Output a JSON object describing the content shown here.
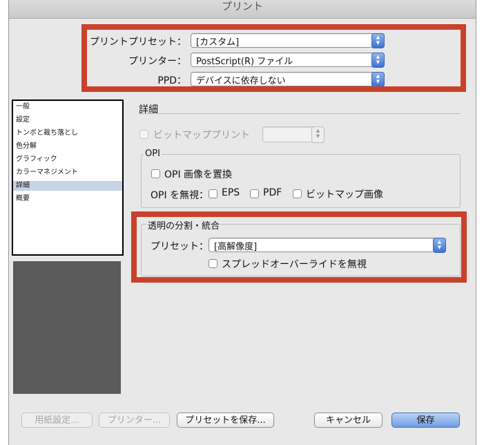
{
  "window": {
    "title": "プリント"
  },
  "top": {
    "preset_label": "プリントプリセット：",
    "preset_value": "[カスタム]",
    "printer_label": "プリンター：",
    "printer_value": "PostScript(R) ファイル",
    "ppd_label": "PPD：",
    "ppd_value": "デバイスに依存しない"
  },
  "sidebar": {
    "items": [
      {
        "label": "一般",
        "selected": false
      },
      {
        "label": "設定",
        "selected": false
      },
      {
        "label": "トンボと裁ち落とし",
        "selected": false
      },
      {
        "label": "色分解",
        "selected": false
      },
      {
        "label": "グラフィック",
        "selected": false
      },
      {
        "label": "カラーマネジメント",
        "selected": false
      },
      {
        "label": "詳細",
        "selected": true
      },
      {
        "label": "概要",
        "selected": false
      }
    ]
  },
  "main": {
    "section_title": "詳細",
    "bitmap_print_label": "ビットマッププリント",
    "bitmap_print_value": "",
    "opi": {
      "group_title": "OPI",
      "replace_label": "OPI 画像を置換",
      "ignore_label": "OPI を無視：",
      "eps_label": "EPS",
      "pdf_label": "PDF",
      "bitmap_label": "ビットマップ画像"
    },
    "flatten": {
      "group_title": "透明の分割・統合",
      "preset_label": "プリセット：",
      "preset_value": "[高解像度]",
      "ignore_overrides_label": "スプレッドオーバーライドを無視"
    }
  },
  "buttons": {
    "page_setup": "用紙設定...",
    "printer": "プリンター...",
    "save_preset": "プリセットを保存...",
    "cancel": "キャンセル",
    "save": "保存"
  },
  "colors": {
    "highlight_box": "#c9412b",
    "selection": "#c6d3e4",
    "preview": "#5b5b5b"
  }
}
